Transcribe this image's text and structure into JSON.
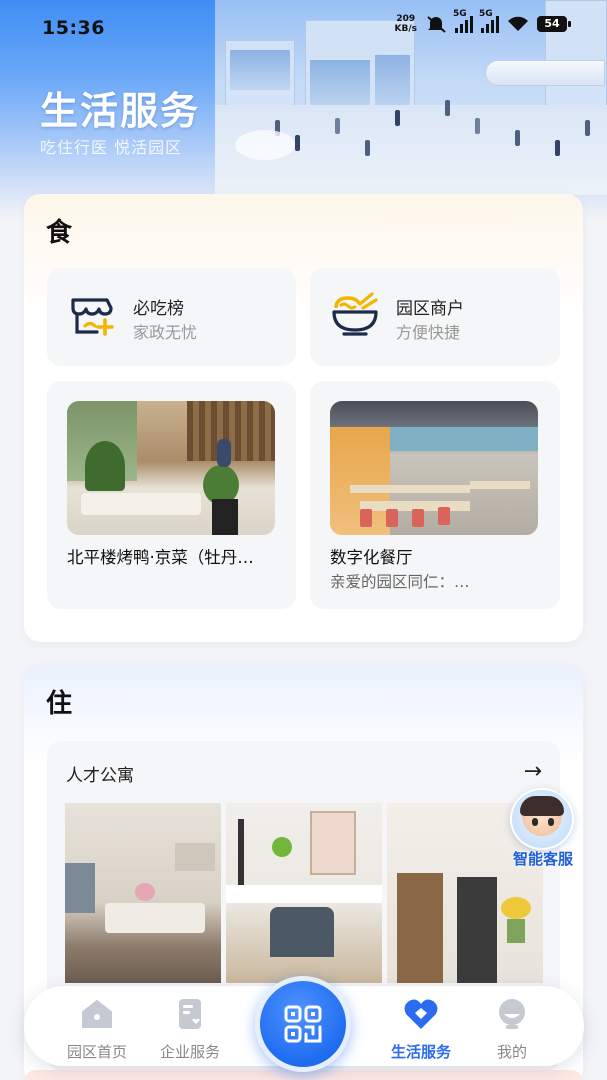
{
  "status_bar": {
    "time": "15:36",
    "net_speed_value": "209",
    "net_speed_unit": "KB/s",
    "sim1": "5G",
    "sim2": "5G",
    "battery": "54"
  },
  "header": {
    "title": "生活服务",
    "subtitle": "吃住行医 悦活园区"
  },
  "food": {
    "section_title": "食",
    "tiles": [
      {
        "title": "必吃榜",
        "subtitle": "家政无忧",
        "icon": "store-plus-icon"
      },
      {
        "title": "园区商户",
        "subtitle": "方便快捷",
        "icon": "noodle-bowl-icon"
      }
    ],
    "features": [
      {
        "title": "北平楼烤鸭·京菜（牡丹…",
        "subtitle": ""
      },
      {
        "title": "数字化餐厅",
        "subtitle": "亲爱的园区同仁：…"
      }
    ]
  },
  "housing": {
    "section_title": "住",
    "card_title": "人才公寓",
    "arrow": "→"
  },
  "assistant": {
    "label": "智能客服"
  },
  "nav": {
    "items": [
      {
        "label": "园区首页",
        "icon": "home-icon",
        "active": false
      },
      {
        "label": "企业服务",
        "icon": "document-heart-icon",
        "active": false
      },
      {
        "label": "生活服务",
        "icon": "heart-diamond-icon",
        "active": true
      },
      {
        "label": "我的",
        "icon": "profile-icon",
        "active": false
      }
    ],
    "center": {
      "icon": "qr-code-icon"
    }
  },
  "colors": {
    "accent": "#2b6cf0",
    "hero_top": "#3f8ef5",
    "muted_text": "#999999"
  }
}
